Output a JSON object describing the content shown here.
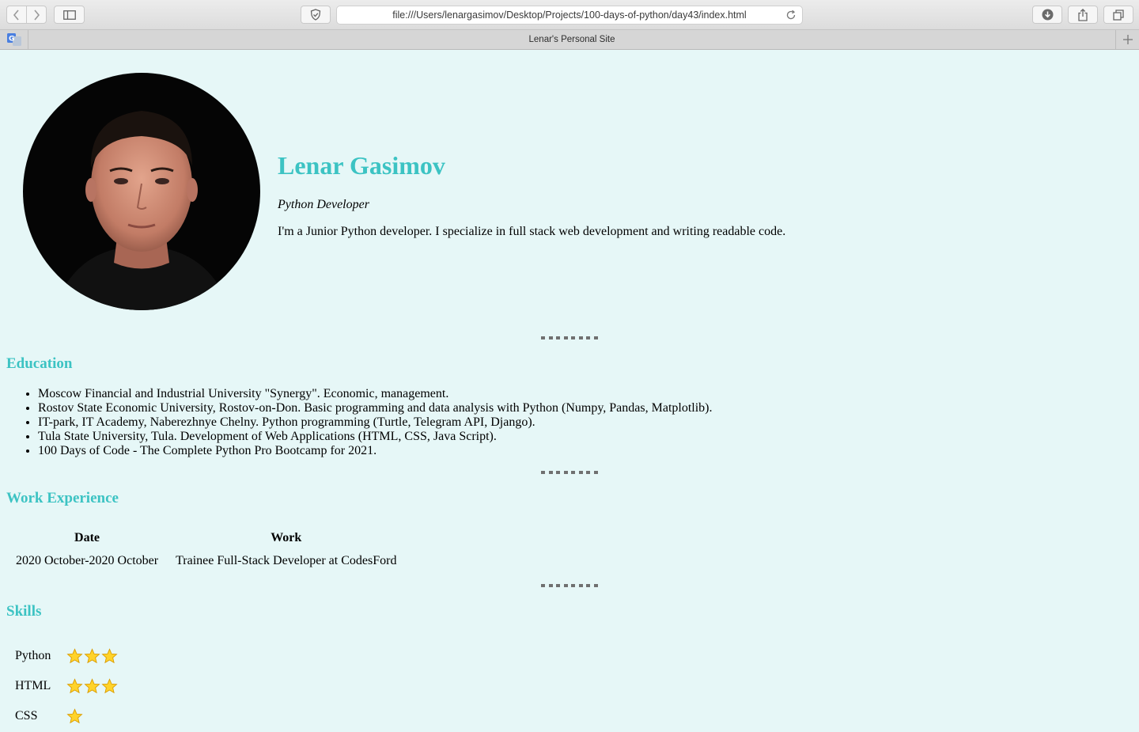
{
  "browser": {
    "url": "file:///Users/lenargasimov/Desktop/Projects/100-days-of-python/day43/index.html",
    "tab_title": "Lenar's Personal Site",
    "icons": [
      "back-icon",
      "forward-icon",
      "sidebar-icon",
      "shield-icon",
      "reload-icon",
      "download-icon",
      "share-icon",
      "tabs-icon",
      "translate-icon",
      "plus-icon"
    ]
  },
  "profile": {
    "name": "Lenar Gasimov",
    "role": "Python Developer",
    "bio": "I'm a Junior Python developer. I specialize in full stack web development and writing readable code."
  },
  "education": {
    "heading": "Education",
    "items": [
      "Moscow Financial and Industrial University \"Synergy\". Economic, management.",
      "Rostov State Economic University, Rostov-on-Don. Basic programming and data analysis with Python (Numpy, Pandas, Matplotlib).",
      "IT-park, IT Academy, Naberezhnye Chelny. Python programming (Turtle, Telegram API, Django).",
      "Tula State University, Tula. Development of Web Applications (HTML, CSS, Java Script).",
      "100 Days of Code - The Complete Python Pro Bootcamp for 2021."
    ]
  },
  "work": {
    "heading": "Work Experience",
    "columns": [
      "Date",
      "Work"
    ],
    "rows": [
      [
        "2020 October-2020 October",
        "Trainee Full-Stack Developer at CodesFord"
      ]
    ]
  },
  "skills": {
    "heading": "Skills",
    "items": [
      {
        "name": "Python",
        "stars": 3
      },
      {
        "name": "HTML",
        "stars": 3
      },
      {
        "name": "CSS",
        "stars": 1
      }
    ]
  },
  "colors": {
    "page_background": "#e6f7f7",
    "accent": "#3cc3c3",
    "divider": "#707070"
  }
}
